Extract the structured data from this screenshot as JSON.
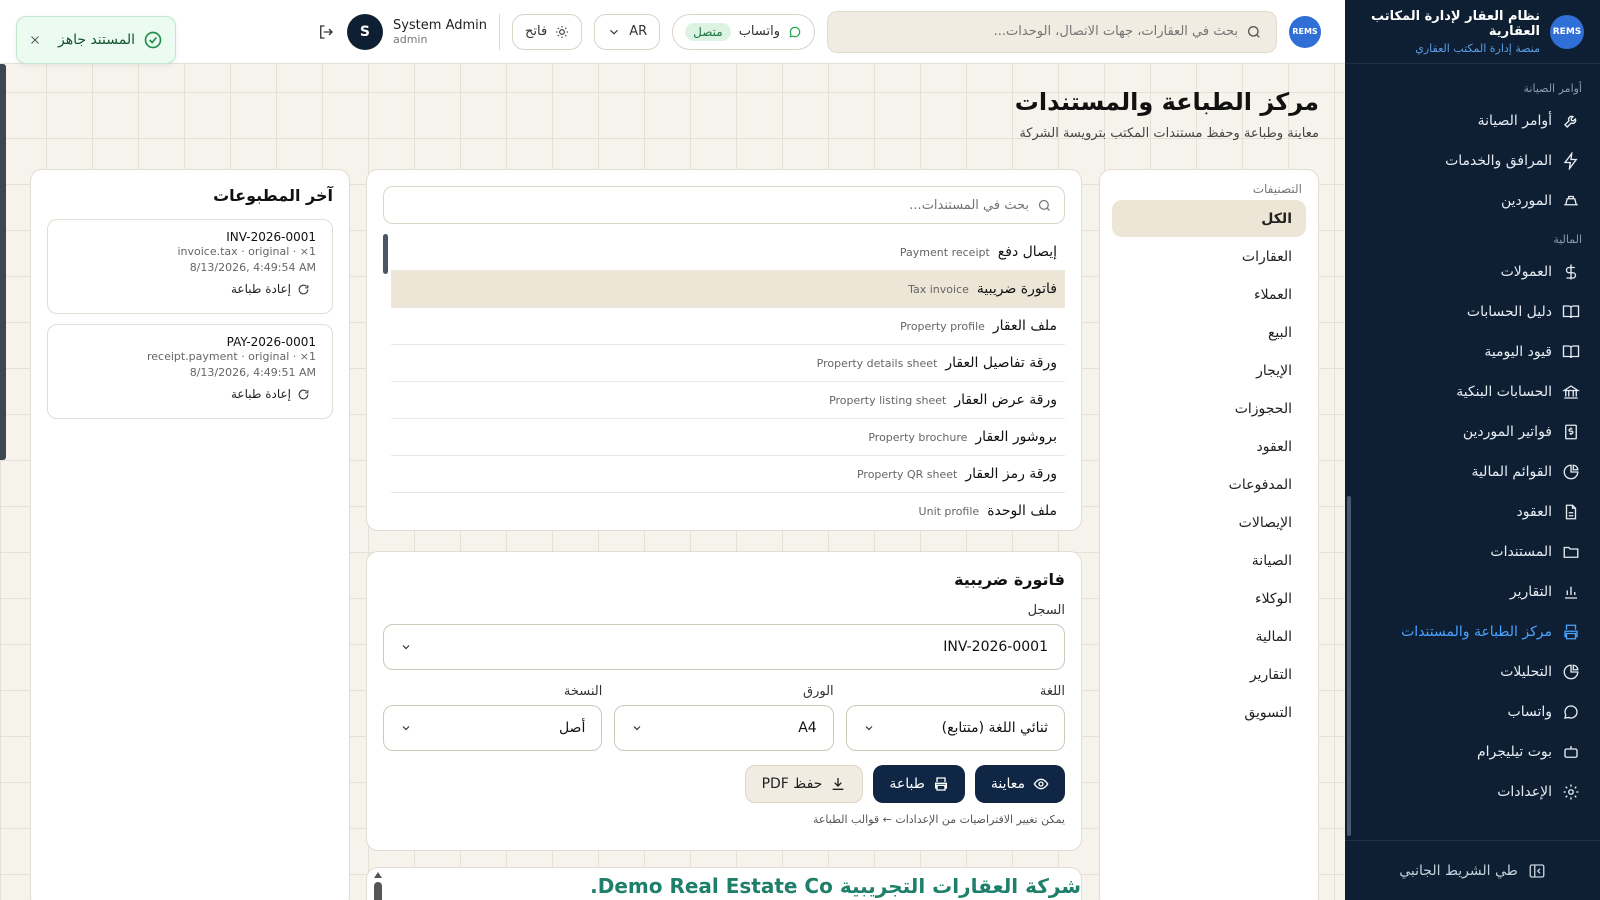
{
  "brand": {
    "title": "نظام العقار لإدارة المكاتب العقارية",
    "subtitle": "منصة إدارة المكتب العقاري",
    "logo_text": "REMS"
  },
  "sidebar": {
    "sections": [
      {
        "label": "أوامر الصيانة",
        "items": [
          {
            "label": "أوامر الصيانة",
            "icon": "wrench-icon"
          },
          {
            "label": "المرافق والخدمات",
            "icon": "bolt-icon"
          },
          {
            "label": "الموردين",
            "icon": "truck-icon"
          }
        ]
      },
      {
        "label": "المالية",
        "items": [
          {
            "label": "العمولات",
            "icon": "dollar-icon"
          },
          {
            "label": "دليل الحسابات",
            "icon": "book-icon"
          },
          {
            "label": "قيود اليومية",
            "icon": "book-open-icon"
          },
          {
            "label": "الحسابات البنكية",
            "icon": "bank-icon"
          },
          {
            "label": "فواتير الموردين",
            "icon": "receipt-icon"
          },
          {
            "label": "القوائم المالية",
            "icon": "pie-chart-icon"
          },
          {
            "label": "العقود",
            "icon": "file-icon"
          },
          {
            "label": "المستندات",
            "icon": "folder-icon"
          },
          {
            "label": "التقارير",
            "icon": "bar-chart-icon"
          },
          {
            "label": "مركز الطباعة والمستندات",
            "icon": "printer-icon",
            "active": true
          },
          {
            "label": "التحليلات",
            "icon": "analytics-icon"
          },
          {
            "label": "واتساب",
            "icon": "chat-icon"
          },
          {
            "label": "بوت تيليجرام",
            "icon": "bot-icon"
          },
          {
            "label": "الإعدادات",
            "icon": "gear-icon"
          }
        ]
      }
    ],
    "collapse_label": "طي الشريط الجانبي"
  },
  "topbar": {
    "search_placeholder": "بحث في العقارات، جهات الاتصال، الوحدات...",
    "whatsapp_label": "واتساب",
    "whatsapp_status": "متصل",
    "language": "AR",
    "theme_label": "فاتح",
    "user_name": "System Admin",
    "user_role": "admin",
    "avatar_initial": "S"
  },
  "toast": {
    "text": "المستند جاهز"
  },
  "page": {
    "title": "مركز الطباعة والمستندات",
    "subtitle": "معاينة وطباعة وحفظ مستندات المكتب بترويسة الشركة"
  },
  "categories": {
    "label": "التصنيفات",
    "items": [
      "الكل",
      "العقارات",
      "العملاء",
      "البيع",
      "الإيجار",
      "الحجوزات",
      "العقود",
      "المدفوعات",
      "الإيصالات",
      "الصيانة",
      "الوكلاء",
      "المالية",
      "التقارير",
      "التسويق"
    ],
    "active_index": 0
  },
  "documents": {
    "search_placeholder": "بحث في المستندات...",
    "items": [
      {
        "ar": "إيصال دفع",
        "en": "Payment receipt"
      },
      {
        "ar": "فاتورة ضريبية",
        "en": "Tax invoice",
        "active": true
      },
      {
        "ar": "ملف العقار",
        "en": "Property profile"
      },
      {
        "ar": "ورقة تفاصيل العقار",
        "en": "Property details sheet"
      },
      {
        "ar": "ورقة عرض العقار",
        "en": "Property listing sheet"
      },
      {
        "ar": "بروشور العقار",
        "en": "Property brochure"
      },
      {
        "ar": "ورقة رمز العقار",
        "en": "Property QR sheet"
      },
      {
        "ar": "ملف الوحدة",
        "en": "Unit profile"
      }
    ]
  },
  "form": {
    "title": "فاتورة ضريبية",
    "record_label": "السجل",
    "record_value": "INV-2026-0001",
    "language_label": "اللغة",
    "language_value": "ثنائي اللغة (متتابع)",
    "paper_label": "الورق",
    "paper_value": "A4",
    "copy_label": "النسخة",
    "copy_value": "أصل",
    "preview_btn": "معاينة",
    "print_btn": "طباعة",
    "pdf_btn": "حفظ PDF",
    "hint": "يمكن تغيير الافتراضيات من الإعدادات ← قوالب الطباعة"
  },
  "preview": {
    "company": "شركة العقارات التجريبية Demo Real Estate Co."
  },
  "recent": {
    "title": "آخر المطبوعات",
    "items": [
      {
        "id": "INV-2026-0001",
        "meta": "invoice.tax · original · ×1",
        "time": "8/13/2026, 4:49:54 AM",
        "reprint": "إعادة طباعة"
      },
      {
        "id": "PAY-2026-0001",
        "meta": "receipt.payment · original · ×1",
        "time": "8/13/2026, 4:49:51 AM",
        "reprint": "إعادة طباعة"
      }
    ]
  }
}
